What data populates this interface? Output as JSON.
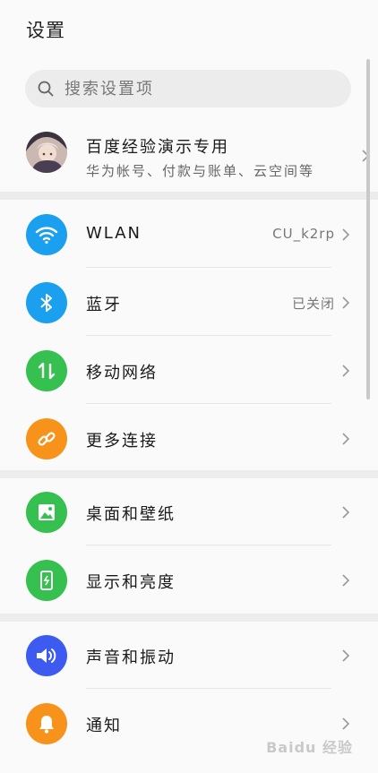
{
  "header": {
    "title": "设置"
  },
  "search": {
    "placeholder": "搜索设置项",
    "icon": "search-icon"
  },
  "account": {
    "name": "百度经验演示专用",
    "subtitle": "华为帐号、付款与账单、云空间等"
  },
  "groups": [
    {
      "items": [
        {
          "label": "WLAN",
          "value": "CU_k2rp",
          "icon": "wifi-icon",
          "color": "#1aa0ef"
        },
        {
          "label": "蓝牙",
          "value": "已关闭",
          "icon": "bluetooth-icon",
          "color": "#1aa0ef"
        },
        {
          "label": "移动网络",
          "value": "",
          "icon": "mobile-network-icon",
          "color": "#35c04f"
        },
        {
          "label": "更多连接",
          "value": "",
          "icon": "link-icon",
          "color": "#f7931a"
        }
      ]
    },
    {
      "items": [
        {
          "label": "桌面和壁纸",
          "value": "",
          "icon": "wallpaper-icon",
          "color": "#35c04f"
        },
        {
          "label": "显示和亮度",
          "value": "",
          "icon": "display-icon",
          "color": "#35c04f"
        }
      ]
    },
    {
      "items": [
        {
          "label": "声音和振动",
          "value": "",
          "icon": "sound-icon",
          "color": "#3d5bf0"
        },
        {
          "label": "通知",
          "value": "",
          "icon": "bell-icon",
          "color": "#f7931a"
        }
      ]
    }
  ],
  "watermark": {
    "text": "Baidu 经验"
  }
}
